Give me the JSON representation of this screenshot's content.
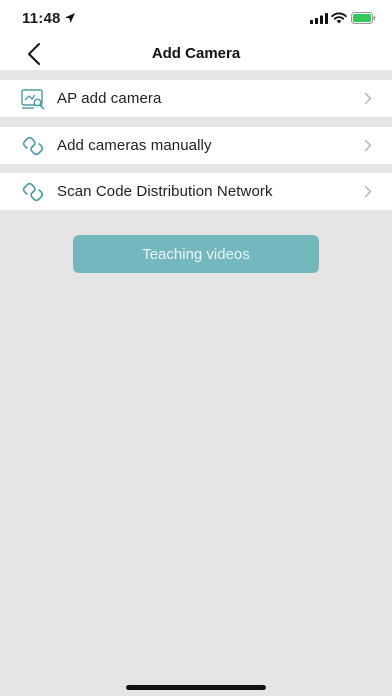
{
  "status_bar": {
    "time": "11:48"
  },
  "nav": {
    "title": "Add Camera"
  },
  "menu": [
    {
      "label": "AP add camera",
      "icon": "ap-camera-icon"
    },
    {
      "label": "Add cameras manually",
      "icon": "link-icon"
    },
    {
      "label": "Scan Code Distribution Network",
      "icon": "link-icon"
    }
  ],
  "teach_button": {
    "label": "Teaching videos"
  },
  "colors": {
    "accent": "#72b8be",
    "icon": "#4a9aa5",
    "background": "#e5e5e5"
  }
}
